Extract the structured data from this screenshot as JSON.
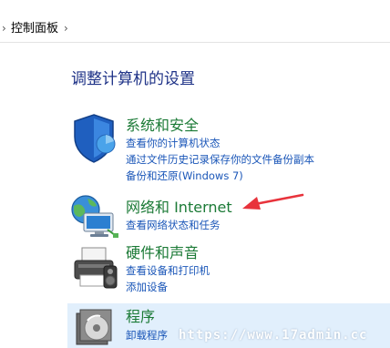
{
  "breadcrumb": {
    "separator_left": "›",
    "label": "控制面板",
    "separator_right": "›"
  },
  "page_title": "调整计算机的设置",
  "categories": [
    {
      "title": "系统和安全",
      "icon": "shield-icon",
      "links": [
        "查看你的计算机状态",
        "通过文件历史记录保存你的文件备份副本",
        "备份和还原(Windows 7)"
      ]
    },
    {
      "title": "网络和 Internet",
      "icon": "network-globe-icon",
      "links": [
        "查看网络状态和任务"
      ]
    },
    {
      "title": "硬件和声音",
      "icon": "printer-icon",
      "links": [
        "查看设备和打印机",
        "添加设备"
      ]
    },
    {
      "title": "程序",
      "icon": "programs-disc-icon",
      "links": [
        "卸载程序"
      ]
    }
  ],
  "annotation": {
    "arrow_color": "#e8333c"
  },
  "watermark": "https://www.17admin.cc",
  "colors": {
    "title_blue": "#1e3287",
    "category_green": "#1b7a36",
    "link_blue": "#1a56b8",
    "highlight": "#e1effc"
  }
}
